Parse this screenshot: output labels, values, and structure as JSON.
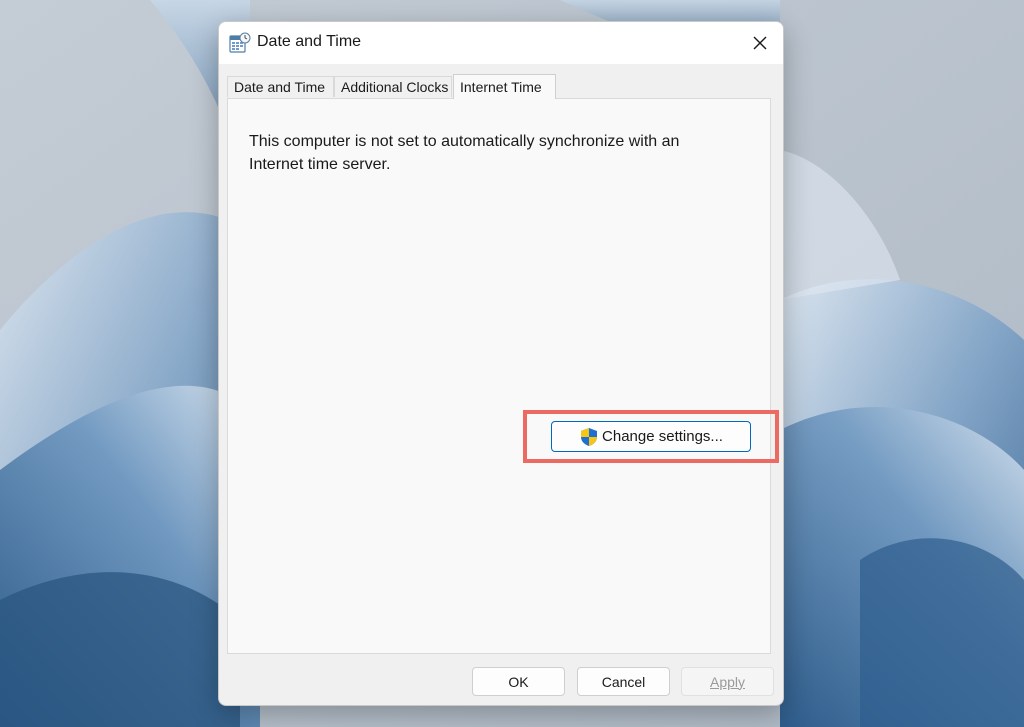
{
  "window": {
    "title": "Date and Time"
  },
  "tabs": [
    {
      "label": "Date and Time",
      "active": false
    },
    {
      "label": "Additional Clocks",
      "active": false
    },
    {
      "label": "Internet Time",
      "active": true
    }
  ],
  "panel": {
    "message": "This computer is not set to automatically synchronize with an Internet time server.",
    "change_button": "Change settings..."
  },
  "buttons": {
    "ok": "OK",
    "cancel": "Cancel",
    "apply": "Apply"
  },
  "colors": {
    "highlight": "#ec6a62",
    "accent": "#0067c0",
    "shield_blue": "#1f6fd1",
    "shield_yellow": "#f5c518"
  },
  "icons": {
    "app": "date-time-icon",
    "close": "close-icon",
    "uac": "uac-shield-icon"
  }
}
